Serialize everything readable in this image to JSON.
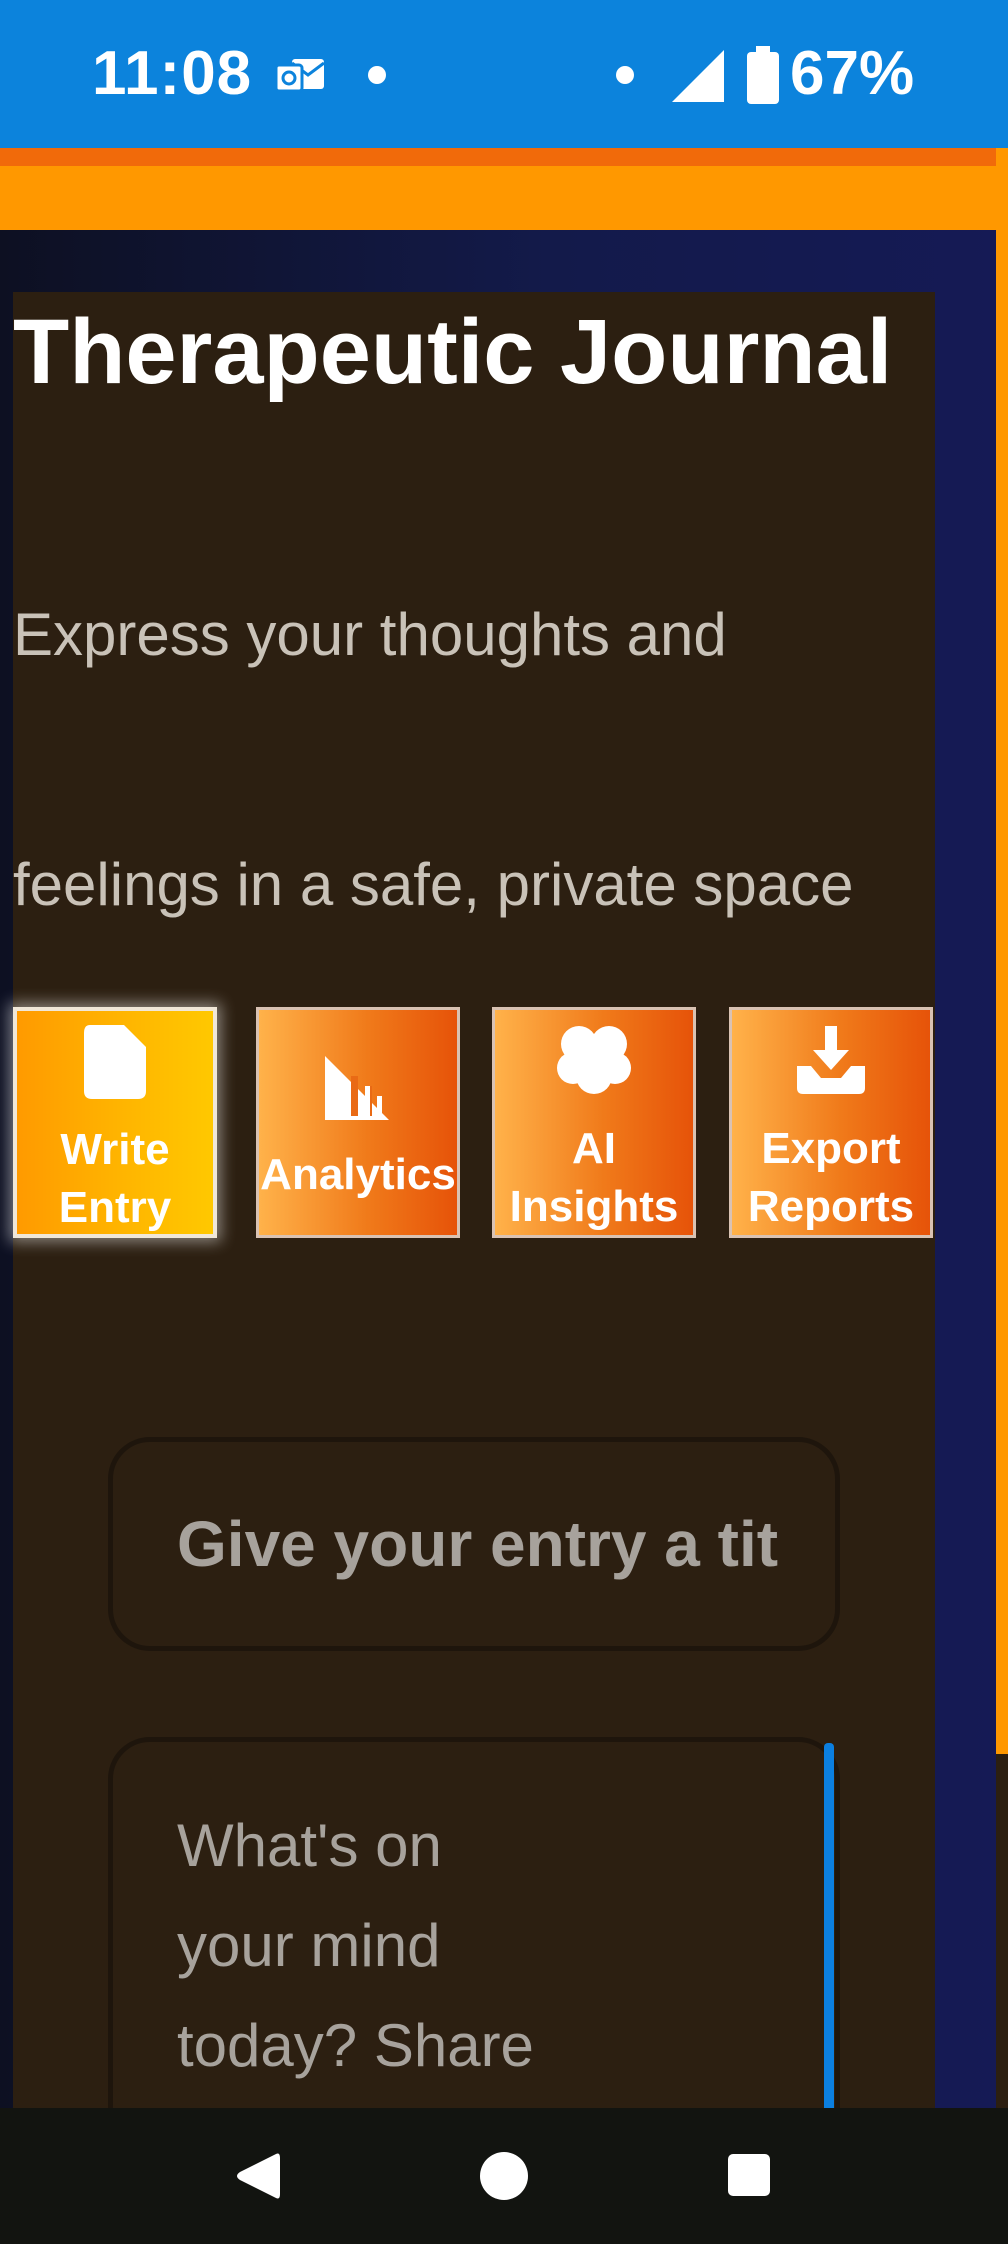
{
  "status_bar": {
    "time": "11:08",
    "battery": "67%",
    "icons": [
      "outlook-icon",
      "dot-icon",
      "dot-icon",
      "signal-icon",
      "battery-icon"
    ]
  },
  "app": {
    "title": "Therapeutic Journal",
    "subtitle": "Express your thoughts and feelings in a safe, private space"
  },
  "actions": [
    {
      "label": "Write Entry",
      "icon": "document-icon",
      "active": true
    },
    {
      "label": "Analytics",
      "icon": "chart-icon",
      "active": false
    },
    {
      "label": "AI Insights",
      "icon": "brain-icon",
      "active": false
    },
    {
      "label": "Export Reports",
      "icon": "download-icon",
      "active": false
    }
  ],
  "entry": {
    "title_placeholder": "Give your entry a title...",
    "title_visible": "Give your entry a tit",
    "body_placeholder": "What's on your mind today? Share"
  },
  "colors": {
    "status_bar": "#0c83dc",
    "accent_orange": "#ff9800",
    "card_bg": "#2c1f11",
    "navy": "#131a4a",
    "scrollbar": "#0b7fe0"
  },
  "nav_bar": {
    "icons": [
      "back-icon",
      "home-icon",
      "recents-icon"
    ]
  }
}
